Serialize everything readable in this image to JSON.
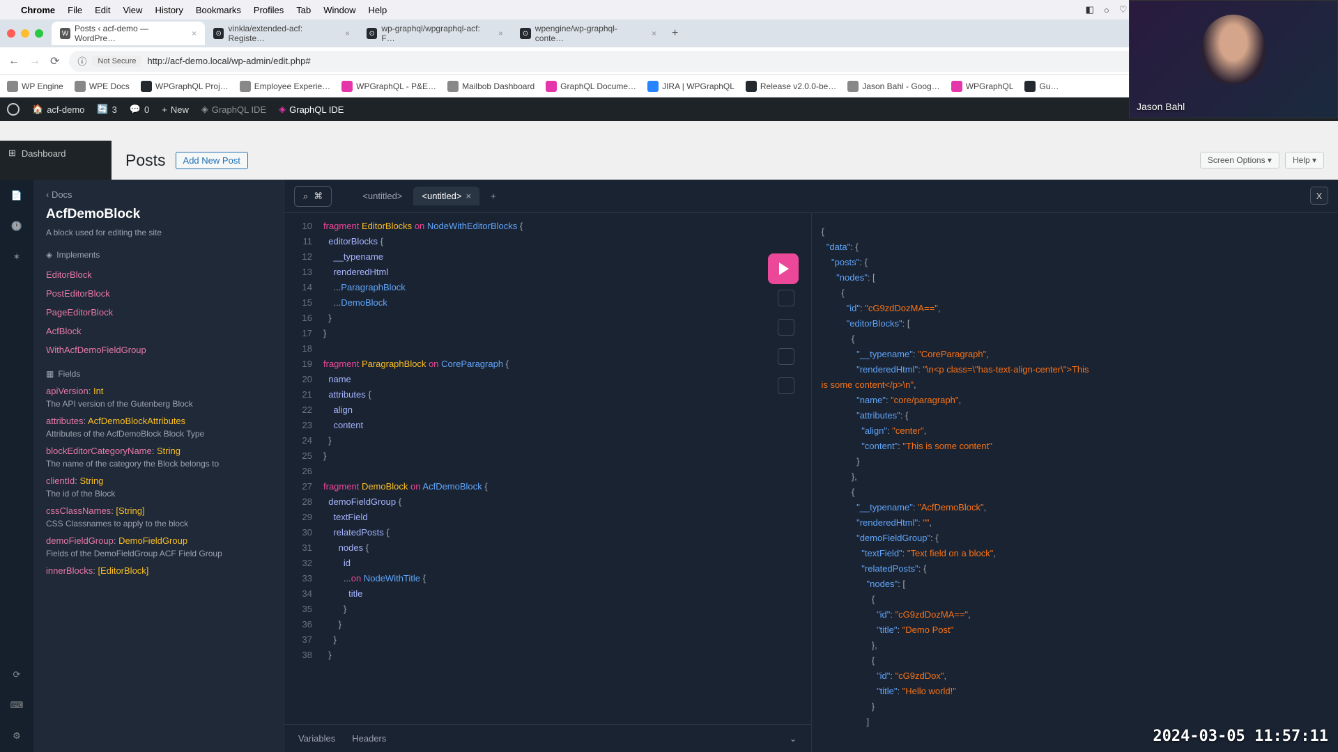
{
  "menubar": {
    "app": "Chrome",
    "items": [
      "File",
      "Edit",
      "View",
      "History",
      "Bookmarks",
      "Profiles",
      "Tab",
      "Window",
      "Help"
    ]
  },
  "tabs": [
    {
      "title": "Posts ‹ acf-demo — WordPre…",
      "active": true
    },
    {
      "title": "vinkla/extended-acf: Registe…",
      "active": false
    },
    {
      "title": "wp-graphql/wpgraphql-acf: F…",
      "active": false
    },
    {
      "title": "wpengine/wp-graphql-conte…",
      "active": false
    }
  ],
  "address": {
    "not_secure": "Not Secure",
    "url": "http://acf-demo.local/wp-admin/edit.php#"
  },
  "bookmarks": [
    "WP Engine",
    "WPE Docs",
    "WPGraphQL Proj…",
    "Employee Experie…",
    "WPGraphQL - P&E…",
    "Mailbob Dashboard",
    "GraphQL Docume…",
    "JIRA | WPGraphQL",
    "Release v2.0.0-be…",
    "Jason Bahl - Goog…",
    "WPGraphQL",
    "Gu…"
  ],
  "wpbar": {
    "site": "acf-demo",
    "updates": "3",
    "comments": "0",
    "new": "New",
    "ide1": "GraphQL IDE",
    "ide2": "GraphQL IDE"
  },
  "wpnav": {
    "dashboard": "Dashboard"
  },
  "posts": {
    "title": "Posts",
    "add": "Add New Post",
    "screen_options": "Screen Options ▾",
    "help": "Help ▾"
  },
  "docs": {
    "back": "‹  Docs",
    "title": "AcfDemoBlock",
    "desc": "A block used for editing the site",
    "implements_label": "Implements",
    "implements": [
      "EditorBlock",
      "PostEditorBlock",
      "PageEditorBlock",
      "AcfBlock",
      "WithAcfDemoFieldGroup"
    ],
    "fields_label": "Fields",
    "fields": [
      {
        "name": "apiVersion",
        "type": "Int",
        "desc": "The API version of the Gutenberg Block"
      },
      {
        "name": "attributes",
        "type": "AcfDemoBlockAttributes",
        "desc": "Attributes of the AcfDemoBlock Block Type"
      },
      {
        "name": "blockEditorCategoryName",
        "type": "String",
        "desc": "The name of the category the Block belongs to"
      },
      {
        "name": "clientId",
        "type": "String",
        "desc": "The id of the Block"
      },
      {
        "name": "cssClassNames",
        "type": "[String]",
        "desc": "CSS Classnames to apply to the block"
      },
      {
        "name": "demoFieldGroup",
        "type": "DemoFieldGroup",
        "desc": "Fields of the DemoFieldGroup ACF Field Group"
      },
      {
        "name": "innerBlocks",
        "type": "[EditorBlock]",
        "desc": ""
      }
    ]
  },
  "editor": {
    "tab1": "<untitled>",
    "tab2": "<untitled>",
    "close": "X",
    "variables": "Variables",
    "headers": "Headers"
  },
  "query_lines": [
    {
      "n": 10,
      "html": "<span class='kw'>fragment</span> <span class='fn'>EditorBlocks</span> <span class='kw'>on</span> <span class='ty'>NodeWithEditorBlocks</span> <span class='pu'>{</span>"
    },
    {
      "n": 11,
      "html": "  <span class='fld'>editorBlocks</span> <span class='pu'>{</span>"
    },
    {
      "n": 12,
      "html": "    <span class='fld'>__typename</span>"
    },
    {
      "n": 13,
      "html": "    <span class='fld'>renderedHtml</span>"
    },
    {
      "n": 14,
      "html": "    <span class='pu'>...</span><span class='ty'>ParagraphBlock</span>"
    },
    {
      "n": 15,
      "html": "    <span class='pu'>...</span><span class='ty'>DemoBlock</span>"
    },
    {
      "n": 16,
      "html": "  <span class='pu'>}</span>"
    },
    {
      "n": 17,
      "html": "<span class='pu'>}</span>"
    },
    {
      "n": 18,
      "html": ""
    },
    {
      "n": 19,
      "html": "<span class='kw'>fragment</span> <span class='fn'>ParagraphBlock</span> <span class='kw'>on</span> <span class='ty'>CoreParagraph</span> <span class='pu'>{</span>"
    },
    {
      "n": 20,
      "html": "  <span class='fld'>name</span>"
    },
    {
      "n": 21,
      "html": "  <span class='fld'>attributes</span> <span class='pu'>{</span>"
    },
    {
      "n": 22,
      "html": "    <span class='fld'>align</span>"
    },
    {
      "n": 23,
      "html": "    <span class='fld'>content</span>"
    },
    {
      "n": 24,
      "html": "  <span class='pu'>}</span>"
    },
    {
      "n": 25,
      "html": "<span class='pu'>}</span>"
    },
    {
      "n": 26,
      "html": ""
    },
    {
      "n": 27,
      "html": "<span class='kw'>fragment</span> <span class='fn'>DemoBlock</span> <span class='kw'>on</span> <span class='ty'>AcfDemoBlock</span> <span class='pu'>{</span>"
    },
    {
      "n": 28,
      "html": "  <span class='fld'>demoFieldGroup</span> <span class='pu'>{</span>"
    },
    {
      "n": 29,
      "html": "    <span class='fld'>textField</span>"
    },
    {
      "n": 30,
      "html": "    <span class='fld'>relatedPosts</span> <span class='pu'>{</span>"
    },
    {
      "n": 31,
      "html": "      <span class='fld'>nodes</span> <span class='pu'>{</span>"
    },
    {
      "n": 32,
      "html": "        <span class='fld'>id</span>"
    },
    {
      "n": 33,
      "html": "        <span class='pu'>...</span><span class='kw'>on</span> <span class='ty'>NodeWithTitle</span> <span class='pu'>{</span>"
    },
    {
      "n": 34,
      "html": "          <span class='fld'>title</span>"
    },
    {
      "n": 35,
      "html": "        <span class='pu'>}</span>"
    },
    {
      "n": 36,
      "html": "      <span class='pu'>}</span>"
    },
    {
      "n": 37,
      "html": "    <span class='pu'>}</span>"
    },
    {
      "n": 38,
      "html": "  <span class='pu'>}</span>"
    }
  ],
  "result_lines": [
    "<span class='pu'>{</span>",
    "  <span class='key'>\"data\"</span><span class='pu'>: {</span>",
    "    <span class='key'>\"posts\"</span><span class='pu'>: {</span>",
    "      <span class='key'>\"nodes\"</span><span class='pu'>: [</span>",
    "        <span class='pu'>{</span>",
    "          <span class='key'>\"id\"</span><span class='pu'>: </span><span class='str'>\"cG9zdDozMA==\"</span><span class='pu'>,</span>",
    "          <span class='key'>\"editorBlocks\"</span><span class='pu'>: [</span>",
    "            <span class='pu'>{</span>",
    "              <span class='key'>\"__typename\"</span><span class='pu'>: </span><span class='str'>\"CoreParagraph\"</span><span class='pu'>,</span>",
    "              <span class='key'>\"renderedHtml\"</span><span class='pu'>: </span><span class='str'>\"\\n&lt;p class=\\\"has-text-align-center\\\"&gt;This</span>",
    "<span class='str'>is some content&lt;/p&gt;\\n\"</span><span class='pu'>,</span>",
    "              <span class='key'>\"name\"</span><span class='pu'>: </span><span class='str'>\"core/paragraph\"</span><span class='pu'>,</span>",
    "              <span class='key'>\"attributes\"</span><span class='pu'>: {</span>",
    "                <span class='key'>\"align\"</span><span class='pu'>: </span><span class='str'>\"center\"</span><span class='pu'>,</span>",
    "                <span class='key'>\"content\"</span><span class='pu'>: </span><span class='str'>\"This is some content\"</span>",
    "              <span class='pu'>}</span>",
    "            <span class='pu'>},</span>",
    "            <span class='pu'>{</span>",
    "              <span class='key'>\"__typename\"</span><span class='pu'>: </span><span class='str'>\"AcfDemoBlock\"</span><span class='pu'>,</span>",
    "              <span class='key'>\"renderedHtml\"</span><span class='pu'>: </span><span class='str'>\"\"</span><span class='pu'>,</span>",
    "              <span class='key'>\"demoFieldGroup\"</span><span class='pu'>: {</span>",
    "                <span class='key'>\"textField\"</span><span class='pu'>: </span><span class='str'>\"Text field on a block\"</span><span class='pu'>,</span>",
    "                <span class='key'>\"relatedPosts\"</span><span class='pu'>: {</span>",
    "                  <span class='key'>\"nodes\"</span><span class='pu'>: [</span>",
    "                    <span class='pu'>{</span>",
    "                      <span class='key'>\"id\"</span><span class='pu'>: </span><span class='str'>\"cG9zdDozMA==\"</span><span class='pu'>,</span>",
    "                      <span class='key'>\"title\"</span><span class='pu'>: </span><span class='str'>\"Demo Post\"</span>",
    "                    <span class='pu'>},</span>",
    "                    <span class='pu'>{</span>",
    "                      <span class='key'>\"id\"</span><span class='pu'>: </span><span class='str'>\"cG9zdDox\"</span><span class='pu'>,</span>",
    "                      <span class='key'>\"title\"</span><span class='pu'>: </span><span class='str'>\"Hello world!\"</span>",
    "                    <span class='pu'>}</span>",
    "                  <span class='pu'>]</span>"
  ],
  "webcam": {
    "name": "Jason Bahl"
  },
  "timestamp": "2024-03-05 11:57:11"
}
